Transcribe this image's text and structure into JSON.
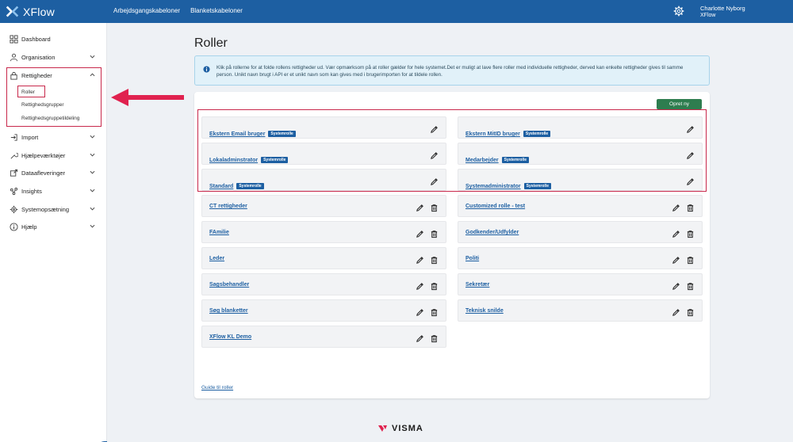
{
  "app": {
    "name": "XFlow"
  },
  "topnav": {
    "items": [
      "Arbejdsgangskabeloner",
      "Blanketskabeloner"
    ]
  },
  "user": {
    "name": "Charlotte Nyborg",
    "org": "XFlow"
  },
  "sidebar": {
    "items": [
      {
        "label": "Dashboard"
      },
      {
        "label": "Organisation"
      },
      {
        "label": "Rettigheder"
      },
      {
        "label": "Import"
      },
      {
        "label": "Hjælpeværktøjer"
      },
      {
        "label": "Dataafleveringer"
      },
      {
        "label": "Insights"
      },
      {
        "label": "Systemopsætning"
      },
      {
        "label": "Hjælp"
      }
    ],
    "subitems": [
      "Roller",
      "Rettighedsgrupper",
      "Rettighedsgruppetildeling"
    ]
  },
  "main": {
    "title": "Roller",
    "info_text": "Klik på rollerne for at folde rollens rettigheder ud. Vær opmærksom på at roller gælder for hele systemet.Det er muligt at lave flere roller med individuelle rettigheder, derved kan enkelte rettigheder gives til samme person. Unikt navn brugt i API er et unikt navn som kan gives med i brugerimporten for at tildele rollen.",
    "create_button": "Opret ny",
    "badge_label": "Systemrolle",
    "guide_link": "Guide til roller",
    "roles": [
      {
        "name": "Ekstern Email bruger",
        "system": true
      },
      {
        "name": "Ekstern MitID bruger",
        "system": true
      },
      {
        "name": "Lokaladminstrator",
        "system": true
      },
      {
        "name": "Medarbejder",
        "system": true
      },
      {
        "name": "Standard",
        "system": true
      },
      {
        "name": "Systemadministrator",
        "system": true
      },
      {
        "name": "CT rettigheder",
        "system": false
      },
      {
        "name": "Customized rolle - test",
        "system": false
      },
      {
        "name": "FAmilie",
        "system": false
      },
      {
        "name": "Godkender/Udfylder",
        "system": false
      },
      {
        "name": "Leder",
        "system": false
      },
      {
        "name": "Politi",
        "system": false
      },
      {
        "name": "Sagsbehandler",
        "system": false
      },
      {
        "name": "Sekretær",
        "system": false
      },
      {
        "name": "Søg blanketter",
        "system": false
      },
      {
        "name": "Teknisk snilde",
        "system": false
      },
      {
        "name": "XFlow KL Demo",
        "system": false
      }
    ]
  },
  "footer": {
    "brand": "VISMA"
  },
  "colors": {
    "primary": "#1d5fa2",
    "success": "#2e7d4f",
    "highlight": "#c8284b",
    "info_bg": "#e1f1f9"
  }
}
